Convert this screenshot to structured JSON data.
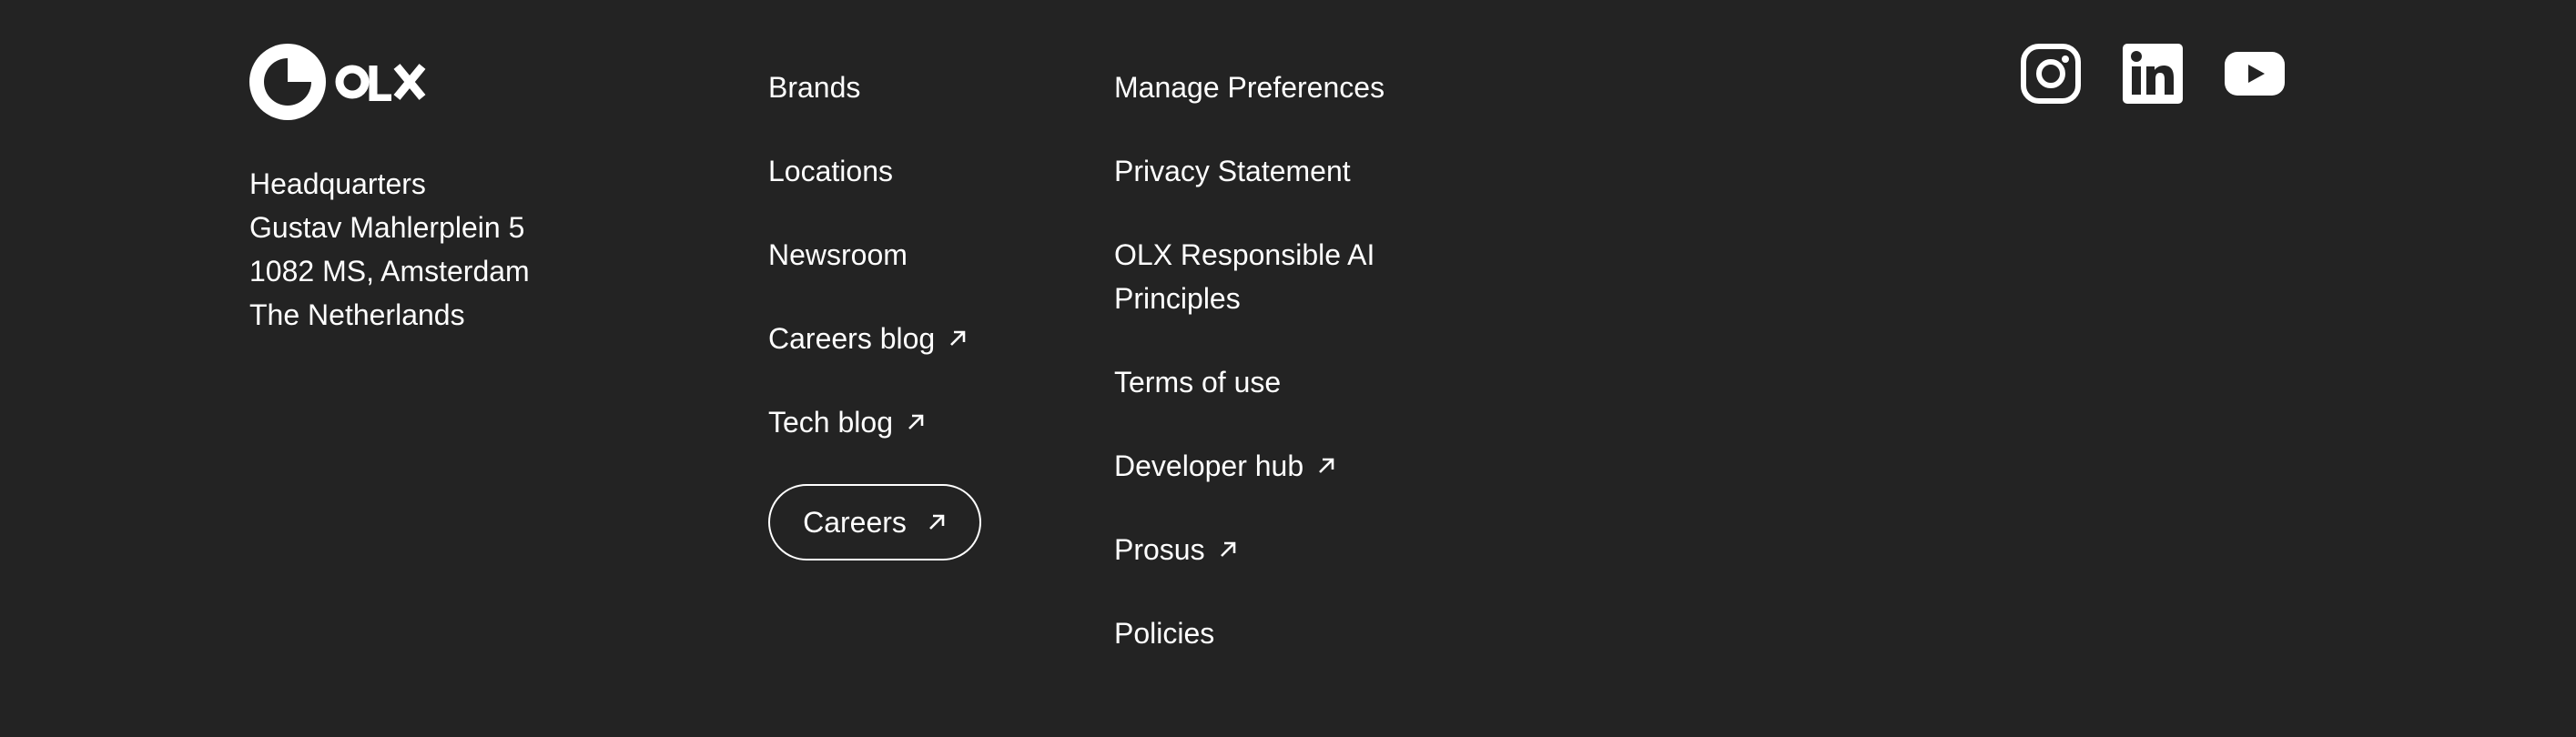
{
  "brand": {
    "logo_text": "OLX"
  },
  "address": {
    "lines": [
      "Headquarters",
      "Gustav Mahlerplein 5",
      "1082 MS, Amsterdam",
      "The Netherlands"
    ]
  },
  "links_col1": [
    {
      "label": "Brands",
      "external": false
    },
    {
      "label": "Locations",
      "external": false
    },
    {
      "label": "Newsroom",
      "external": false
    },
    {
      "label": "Careers blog",
      "external": true
    },
    {
      "label": "Tech blog",
      "external": true
    }
  ],
  "careers_button": {
    "label": "Careers"
  },
  "links_col2": [
    {
      "label": "Manage Preferences",
      "external": false
    },
    {
      "label": "Privacy Statement",
      "external": false
    },
    {
      "label": "OLX Responsible AI Principles",
      "external": false
    },
    {
      "label": "Terms of use",
      "external": false
    },
    {
      "label": "Developer hub",
      "external": true
    },
    {
      "label": "Prosus",
      "external": true
    },
    {
      "label": "Policies",
      "external": false
    }
  ],
  "social": [
    {
      "name": "instagram-icon"
    },
    {
      "name": "linkedin-icon"
    },
    {
      "name": "youtube-icon"
    }
  ],
  "colors": {
    "background": "#232323",
    "text": "#ffffff"
  }
}
